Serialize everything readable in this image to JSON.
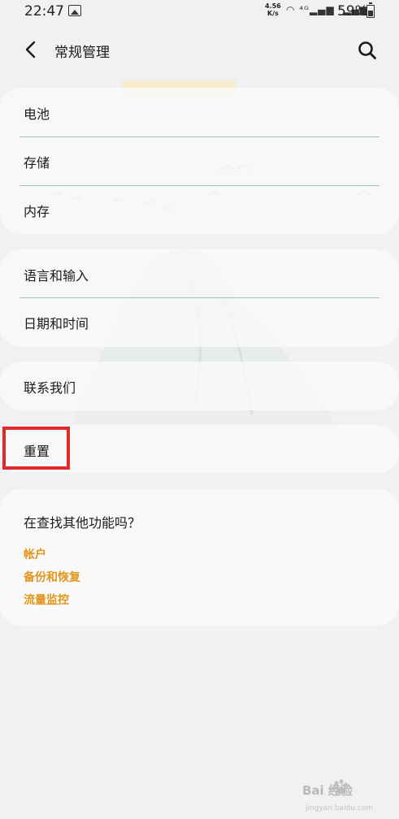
{
  "status_bar": {
    "time": "22:47",
    "speed_top": "4.56",
    "speed_bottom": "K/s",
    "signal_icons": "◠ ⁴ᴳ▂▄▆ ᴱ▂▄▆",
    "battery": "59%"
  },
  "header": {
    "title": "常规管理"
  },
  "groups": [
    {
      "items": [
        {
          "label": "电池"
        },
        {
          "label": "存储"
        },
        {
          "label": "内存"
        }
      ]
    },
    {
      "items": [
        {
          "label": "语言和输入"
        },
        {
          "label": "日期和时间"
        }
      ]
    },
    {
      "items": [
        {
          "label": "联系我们"
        }
      ]
    },
    {
      "items": [
        {
          "label": "重置"
        }
      ]
    }
  ],
  "more": {
    "title": "在查找其他功能吗？",
    "links": [
      {
        "label": "帐户"
      },
      {
        "label": "备份和恢复"
      },
      {
        "label": "流量监控"
      }
    ]
  },
  "watermark": {
    "text": "Bai 经验",
    "sub": "jingyan.baidu.com"
  },
  "colors": {
    "accent": "#e3951a",
    "divider": "#9fc1b4",
    "highlight": "#e02a2a",
    "background": "#f1f1f3"
  }
}
